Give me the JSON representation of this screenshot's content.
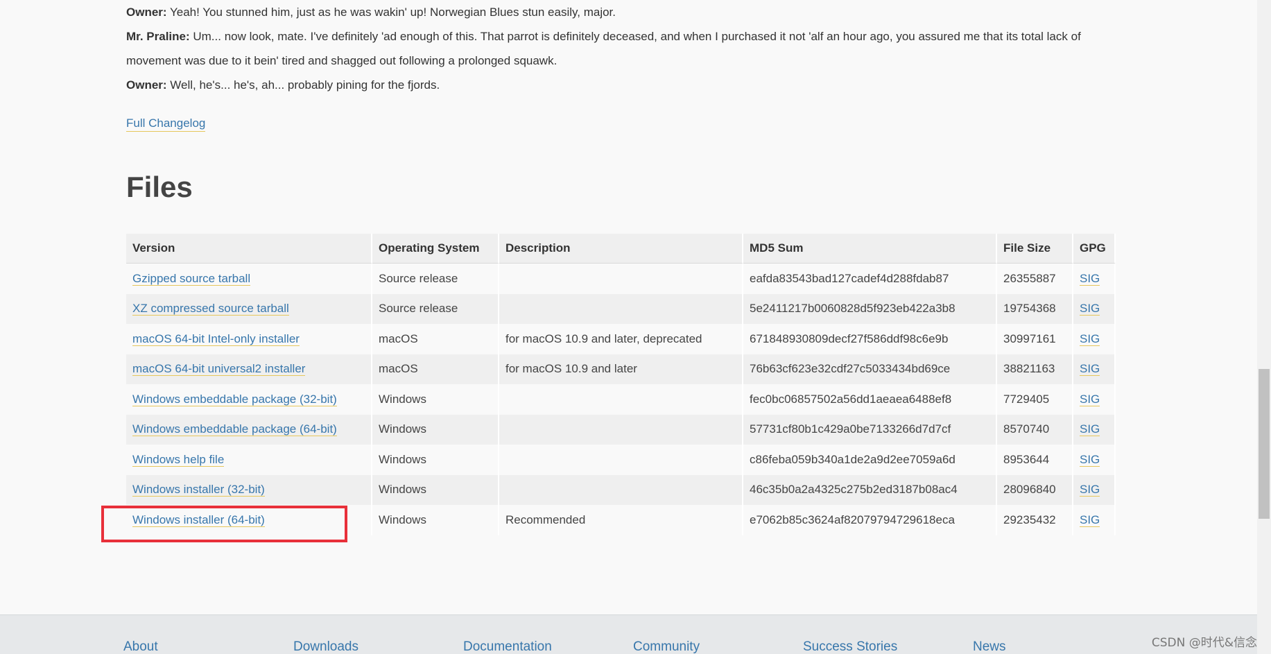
{
  "dialogue": [
    {
      "speaker": "Owner:",
      "text": " Yeah! You stunned him, just as he was wakin' up! Norwegian Blues stun easily, major."
    },
    {
      "speaker": "Mr. Praline:",
      "text": " Um... now look, mate. I've definitely 'ad enough of this. That parrot is definitely deceased, and when I purchased it not 'alf an hour ago, you assured me that its total lack of movement was due to it bein' tired and shagged out following a prolonged squawk."
    },
    {
      "speaker": "Owner:",
      "text": " Well, he's... he's, ah... probably pining for the fjords."
    }
  ],
  "changelog_link": "Full Changelog",
  "files_heading": "Files",
  "table": {
    "headers": [
      "Version",
      "Operating System",
      "Description",
      "MD5 Sum",
      "File Size",
      "GPG"
    ],
    "rows": [
      {
        "version": "Gzipped source tarball",
        "os": "Source release",
        "description": "",
        "md5": "eafda83543bad127cadef4d288fdab87",
        "size": "26355887",
        "gpg": "SIG"
      },
      {
        "version": "XZ compressed source tarball",
        "os": "Source release",
        "description": "",
        "md5": "5e2411217b0060828d5f923eb422a3b8",
        "size": "19754368",
        "gpg": "SIG"
      },
      {
        "version": "macOS 64-bit Intel-only installer",
        "os": "macOS",
        "description": "for macOS 10.9 and later, deprecated",
        "md5": "671848930809decf27f586ddf98c6e9b",
        "size": "30997161",
        "gpg": "SIG"
      },
      {
        "version": "macOS 64-bit universal2 installer",
        "os": "macOS",
        "description": "for macOS 10.9 and later",
        "md5": "76b63cf623e32cdf27c5033434bd69ce",
        "size": "38821163",
        "gpg": "SIG"
      },
      {
        "version": "Windows embeddable package (32-bit)",
        "os": "Windows",
        "description": "",
        "md5": "fec0bc06857502a56dd1aeaea6488ef8",
        "size": "7729405",
        "gpg": "SIG"
      },
      {
        "version": "Windows embeddable package (64-bit)",
        "os": "Windows",
        "description": "",
        "md5": "57731cf80b1c429a0be7133266d7d7cf",
        "size": "8570740",
        "gpg": "SIG"
      },
      {
        "version": "Windows help file",
        "os": "Windows",
        "description": "",
        "md5": "c86feba059b340a1de2a9d2ee7059a6d",
        "size": "8953644",
        "gpg": "SIG"
      },
      {
        "version": "Windows installer (32-bit)",
        "os": "Windows",
        "description": "",
        "md5": "46c35b0a2a4325c275b2ed3187b08ac4",
        "size": "28096840",
        "gpg": "SIG"
      },
      {
        "version": "Windows installer (64-bit)",
        "os": "Windows",
        "description": "Recommended",
        "md5": "e7062b85c3624af82079794729618eca",
        "size": "29235432",
        "gpg": "SIG"
      }
    ]
  },
  "highlight_color": "#e8303a",
  "link_color": "#3776ab",
  "footer": {
    "links": [
      "About",
      "Downloads",
      "Documentation",
      "Community",
      "Success Stories",
      "News"
    ]
  },
  "watermark": "CSDN @时代&信念"
}
